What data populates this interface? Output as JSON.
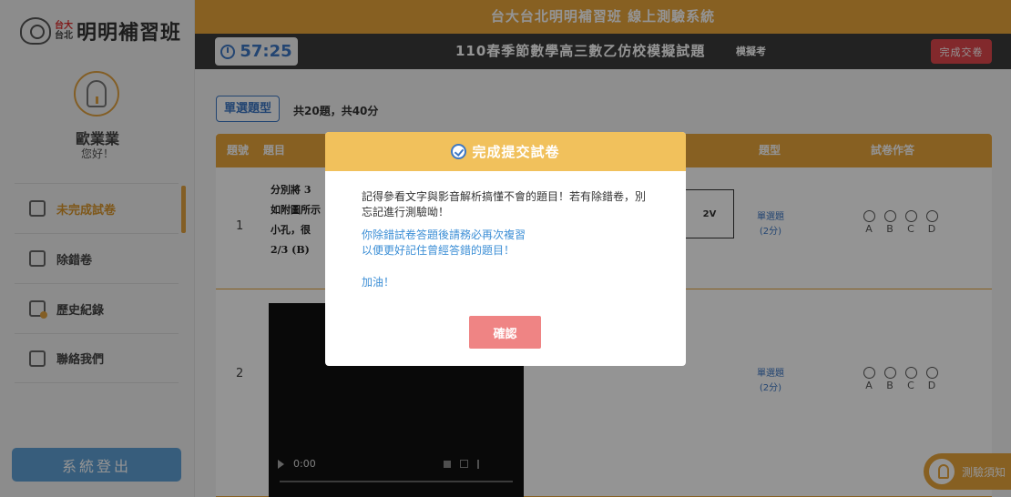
{
  "sidebar": {
    "logo": {
      "small_top": "台大",
      "small_bottom": "台北",
      "name": "明明補習班"
    },
    "user": {
      "name": "歐業業",
      "greeting": "您好！"
    },
    "nav": [
      {
        "label": "未完成試卷",
        "icon": "exam-edit-icon",
        "active": true
      },
      {
        "label": "除錯卷",
        "icon": "debug-sheet-icon",
        "active": false
      },
      {
        "label": "歷史紀錄",
        "icon": "history-icon",
        "active": false
      },
      {
        "label": "聯絡我們",
        "icon": "contact-icon",
        "active": false
      }
    ],
    "logout_label": "系統登出"
  },
  "header": {
    "system_title": "台大台北明明補習班 線上測驗系統",
    "timer": "57:25",
    "exam_title": "110春季節數學高三數乙仿校模擬試題",
    "exam_mode": "模擬考",
    "submit_label": "完成交卷"
  },
  "main": {
    "section_type": "單選題型",
    "section_info": "共20題，共40分",
    "columns": {
      "num": "題號",
      "question": "題目",
      "type": "題型",
      "answer": "試卷作答"
    },
    "questions": [
      {
        "num": "1",
        "text_lines": [
          "分別將 3",
          "如附圖所示",
          "小孔，很",
          "2/3  (B)"
        ],
        "circuit_label": "2V",
        "type_label": "單選題",
        "points": "(2分)",
        "options": [
          "A",
          "B",
          "C",
          "D"
        ]
      },
      {
        "num": "2",
        "video_time": "0:00",
        "type_label": "單選題",
        "points": "(2分)",
        "options": [
          "A",
          "B",
          "C",
          "D"
        ]
      }
    ],
    "notice_label": "測驗須知"
  },
  "modal": {
    "title": "完成提交試卷",
    "message": "記得參看文字與影音解析搞懂不會的題目！若有除錯卷，別忘記進行測驗呦！",
    "tip_line1": "你除錯試卷答題後請務必再次複習",
    "tip_line2": "以便更好記住曾經答錯的題目！",
    "cheer": "加油！",
    "confirm_label": "確認"
  },
  "colors": {
    "accent_orange": "#e8a53c",
    "modal_header": "#f1c15c",
    "link_blue": "#3d8fd6",
    "submit_red": "#e0474c",
    "confirm_pink": "#ef8484",
    "logout_blue": "#5fa0d6"
  }
}
